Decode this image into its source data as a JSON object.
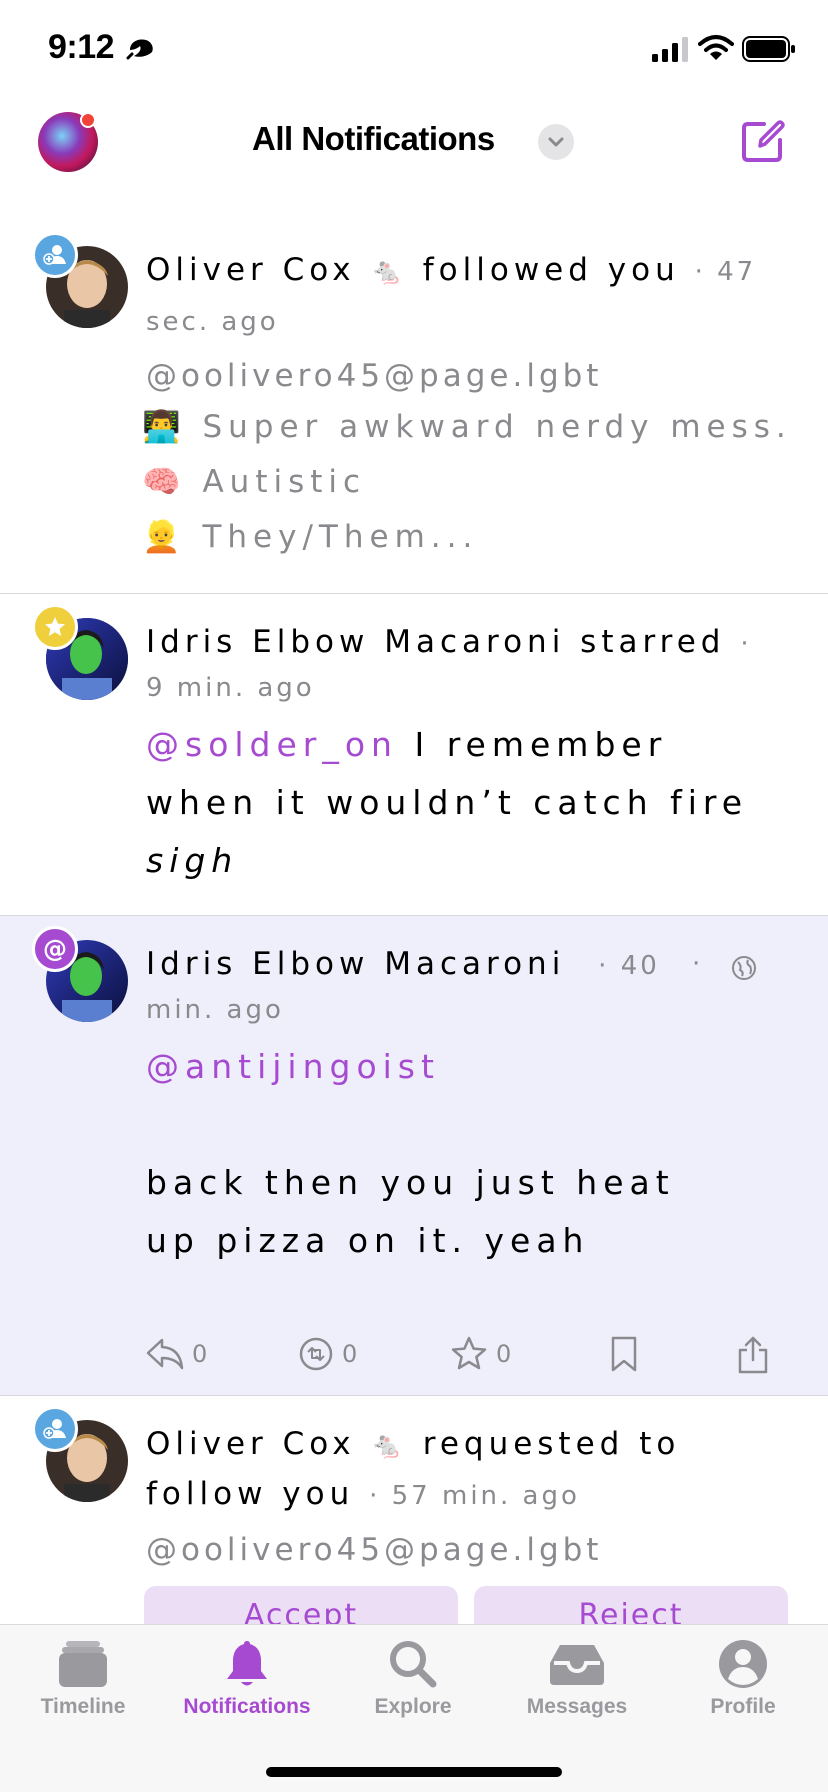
{
  "status": {
    "time": "9:12"
  },
  "header": {
    "title": "All Notifications"
  },
  "notifications": [
    {
      "type": "follow",
      "name": "Oliver Cox",
      "emoji": "🐁",
      "action": "followed you",
      "time": "47 sec. ago",
      "handle": "@oolivero45@page.lgbt",
      "bio": [
        {
          "emoji": "👨‍💻",
          "text": "Super awkward nerdy mess."
        },
        {
          "emoji": "🧠",
          "text": "Autistic"
        },
        {
          "emoji": "👱",
          "text": "They/Them..."
        }
      ]
    },
    {
      "type": "star",
      "name": "Idris Elbow Macaroni",
      "action": "starred",
      "time": "9 min. ago",
      "mention": "@solder_on",
      "text_1": "I remember",
      "text_2": "when it wouldn’t catch fire",
      "text_3": "sigh"
    },
    {
      "type": "mention",
      "name": "Idris Elbow Macaroni",
      "time_1": "40",
      "time_2": "min. ago",
      "mention": "@antijingoist",
      "line_1": "back then you just heat",
      "line_2": "up pizza on it. yeah",
      "counts": {
        "reply": "0",
        "boost": "0",
        "star": "0"
      }
    },
    {
      "type": "follow_request",
      "name": "Oliver Cox",
      "emoji": "🐁",
      "action_1": "requested to",
      "action_2": "follow you",
      "time": "57 min. ago",
      "handle": "@oolivero45@page.lgbt",
      "accept_label": "Accept",
      "reject_label": "Reject"
    }
  ],
  "tabs": [
    {
      "label": "Timeline",
      "icon": "timeline-icon"
    },
    {
      "label": "Notifications",
      "icon": "bell-icon",
      "active": true
    },
    {
      "label": "Explore",
      "icon": "magnifier-icon"
    },
    {
      "label": "Messages",
      "icon": "inbox-icon"
    },
    {
      "label": "Profile",
      "icon": "person-icon"
    }
  ],
  "colors": {
    "accent": "#a64bd1",
    "highlight": "#efeefb",
    "meta": "#8a8a8e"
  }
}
